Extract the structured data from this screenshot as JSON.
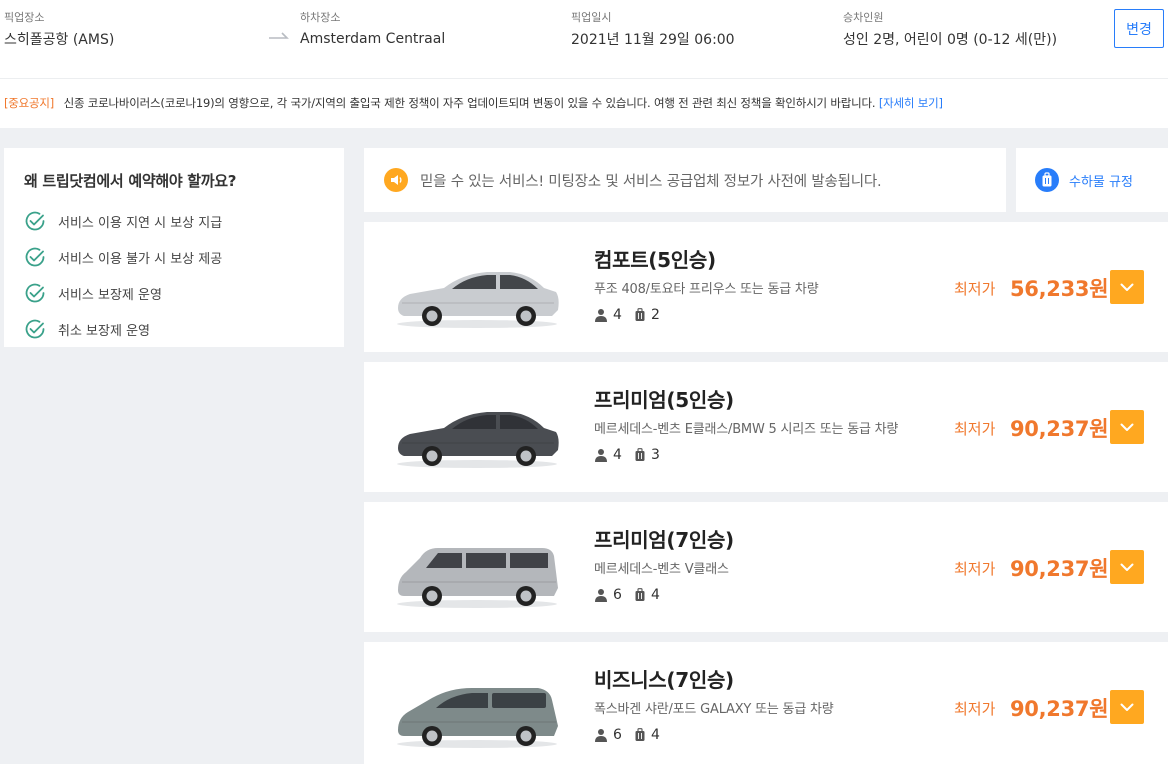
{
  "search": {
    "pickup_label": "픽업장소",
    "pickup_value": "스히폴공항 (AMS)",
    "dropoff_label": "하차장소",
    "dropoff_value": "Amsterdam Centraal",
    "datetime_label": "픽업일시",
    "datetime_value": "2021년 11월 29일 06:00",
    "passengers_label": "승차인원",
    "passengers_value": "성인 2명, 어린이 0명 (0-12 세(만))",
    "change_button": "변경"
  },
  "notice": {
    "tag": "[중요공지]",
    "text": "신종 코로나바이러스(코로나19)의 영향으로, 각 국가/지역의 출입국 제한 정책이 자주 업데이트되며 변동이 있을 수 있습니다. 여행 전 관련 최신 정책을 확인하시기 바랍니다.",
    "link": "[자세히 보기]"
  },
  "why": {
    "title": "왜 트립닷컴에서 예약해야 할까요?",
    "items": [
      "서비스 이용 지연 시 보상 지급",
      "서비스 이용 불가 시 보상 제공",
      "서비스 보장제 운영",
      "취소 보장제 운영"
    ]
  },
  "banner": {
    "text": "믿을 수 있는 서비스! 미팅장소 및 서비스 공급업체 정보가 사전에 발송됩니다.",
    "luggage_link": "수하물 규정"
  },
  "vehicles": [
    {
      "name": "컴포트(5인승)",
      "model": "푸조 408/토요타 프리우스 또는 동급 차량",
      "passengers": "4",
      "luggage": "2",
      "price_label": "최저가",
      "price": "56,233원",
      "body_color": "#c9ccd0",
      "type": "sedan"
    },
    {
      "name": "프리미엄(5인승)",
      "model": "메르세데스-벤츠 E클래스/BMW 5 시리즈 또는 동급 차량",
      "passengers": "4",
      "luggage": "3",
      "price_label": "최저가",
      "price": "90,237원",
      "body_color": "#4a4d52",
      "type": "sedan"
    },
    {
      "name": "프리미엄(7인승)",
      "model": "메르세데스-벤츠 V클래스",
      "passengers": "6",
      "luggage": "4",
      "price_label": "최저가",
      "price": "90,237원",
      "body_color": "#b4b7bb",
      "type": "van"
    },
    {
      "name": "비즈니스(7인승)",
      "model": "폭스바겐 샤란/포드 GALAXY 또는 동급 차량",
      "passengers": "6",
      "luggage": "4",
      "price_label": "최저가",
      "price": "90,237원",
      "body_color": "#7e8a8a",
      "type": "mpv"
    }
  ],
  "colors": {
    "accent_orange": "#f0782d",
    "button_yellow": "#ffa820",
    "link_blue": "#287dfa",
    "check_green": "#3aa18a"
  }
}
